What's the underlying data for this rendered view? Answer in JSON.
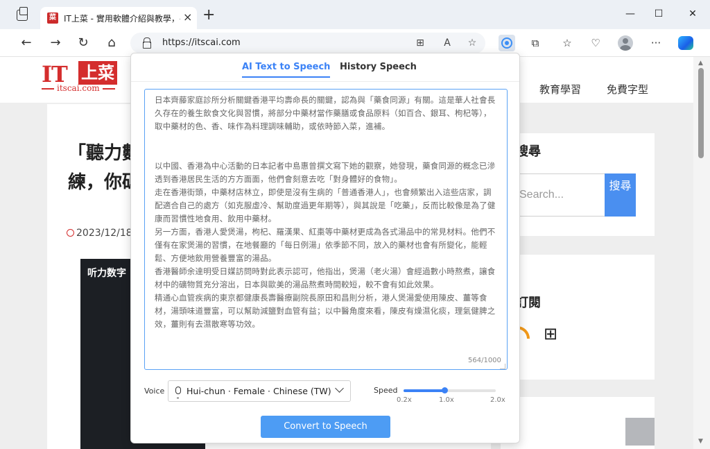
{
  "browser": {
    "tab_title": "IT上菜 - 實用軟體介紹與教學，手",
    "tab_favicon": "菜",
    "url": "https://itscai.com"
  },
  "page": {
    "logo_text": "IT",
    "logo_box": "上菜",
    "logo_domain": "itscai.com",
    "nav": [
      "教育學習",
      "免費字型"
    ],
    "article_title": "「聽力數字訓練，你碼",
    "article_date": "2023/12/18",
    "video_caption": "听力数字",
    "sidebar_search_heading": "搜尋",
    "search_placeholder": "Search...",
    "search_button": "搜尋",
    "subscribe_heading": "訂閱"
  },
  "popup": {
    "tabs": [
      "AI Text to Speech",
      "History Speech"
    ],
    "text": "日本齊藤家庭診所分析關鍵香港平均壽命長的關鍵，認為與「藥食同源」有關。這是華人社會長久存在的養生飲食文化與習慣，將部分中藥材當作藥膳或食品原料（如百合、銀耳、枸杞等），取中藥材的色、香、味作為料理調味輔助，或依時節入菜，進補。\n\n\n以中國、香港為中心活動的日本記者中島惠曾撰文寫下她的觀察，她發現，藥食同源的概念已滲透到香港居民生活的方方面面，他們會刻意去吃「對身體好的食物」。\n走在香港街頭，中藥材店林立，即使是沒有生病的「普通香港人」，也會頻繁出入這些店家，調配適合自己的處方（如克服虛冷、幫助度過更年期等），與其說是「吃藥」，反而比較像是為了健康而習慣性地食用、飲用中藥材。\n另一方面，香港人愛煲湯，枸杞、羅漢果、紅棗等中藥材更成為各式湯品中的常見材料。他們不僅有在家煲湯的習慣，在地餐廳的「每日例湯」依季節不同，放入的藥材也會有所變化，能輕鬆、方便地飲用營養豐富的湯品。\n香港醫師余達明受日媒訪問時對此表示認可，他指出，煲湯（老火湯）會經過數小時熬煮，讓食材中的礦物質充分溶出，日本與歐美的湯品熬煮時間較短，較不會有如此效果。\n精通心血管疾病的東京都健康長壽醫療副院長原田和昌則分析，港人煲湯愛使用陳皮、薑等食材，湯頭味道豐富，可以幫助減鹽對血管有益；以中醫角度來看，陳皮有燥濕化痰，理氣健脾之效，薑則有去濕散寒等功效。",
    "char_count": "564/1000",
    "voice_label": "Voice",
    "voice_value": "Hui-chun · Female · Chinese (TW)",
    "speed_label": "Speed",
    "speed": {
      "min": 0.2,
      "max": 2.0,
      "value": 1.0
    },
    "speed_ticks": [
      "0.2x",
      "1.0x",
      "2.0x"
    ],
    "convert_button": "Convert to Speech"
  },
  "colors": {
    "accent": "#3b82f6",
    "brand": "#d42d2d"
  }
}
